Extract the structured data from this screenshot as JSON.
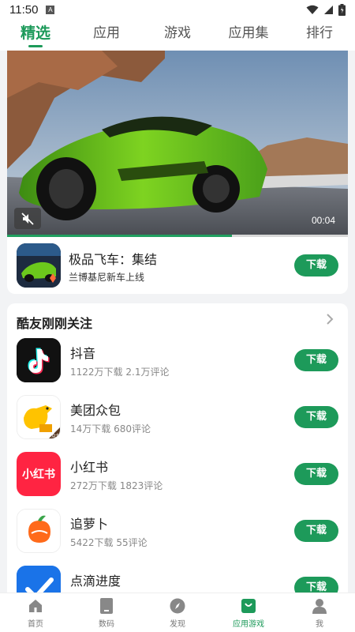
{
  "status_bar": {
    "time": "11:50",
    "notif_letter": "A"
  },
  "tabs": [
    {
      "label": "精选",
      "active": true
    },
    {
      "label": "应用",
      "active": false
    },
    {
      "label": "游戏",
      "active": false
    },
    {
      "label": "应用集",
      "active": false
    },
    {
      "label": "排行",
      "active": false
    }
  ],
  "featured": {
    "video_time": "00:04",
    "progress": 0.66,
    "title": "极品飞车：集结",
    "subtitle": "兰博基尼新车上线",
    "download_label": "下载",
    "icon_name": "nfs-game-icon"
  },
  "section": {
    "title": "酷友刚刚关注",
    "apps": [
      {
        "name": "抖音",
        "downloads": "1122万下载",
        "comments": "2.1万评论",
        "download_label": "下载",
        "icon_name": "douyin-icon"
      },
      {
        "name": "美团众包",
        "downloads": "14万下载",
        "comments": "680评论",
        "download_label": "下载",
        "icon_name": "meituan-zhongbao-icon",
        "icon_badge": "众包"
      },
      {
        "name": "小红书",
        "downloads": "272万下载",
        "comments": "1823评论",
        "download_label": "下载",
        "icon_name": "xiaohongshu-icon",
        "icon_text": "小红书"
      },
      {
        "name": "追萝卜",
        "downloads": "5422下载",
        "comments": "55评论",
        "download_label": "下载",
        "icon_name": "zhuiluobo-icon"
      },
      {
        "name": "点滴进度",
        "downloads": "",
        "comments": "",
        "download_label": "下载",
        "icon_name": "diandi-progress-icon"
      }
    ]
  },
  "bottom_nav": [
    {
      "label": "首页",
      "icon": "home-icon",
      "active": false
    },
    {
      "label": "数码",
      "icon": "phone-icon",
      "active": false
    },
    {
      "label": "发现",
      "icon": "compass-icon",
      "active": false
    },
    {
      "label": "应用游戏",
      "icon": "bag-icon",
      "active": true
    },
    {
      "label": "我",
      "icon": "person-icon",
      "active": false
    }
  ],
  "colors": {
    "accent": "#1d9a5a",
    "background": "#f2f3f5"
  }
}
